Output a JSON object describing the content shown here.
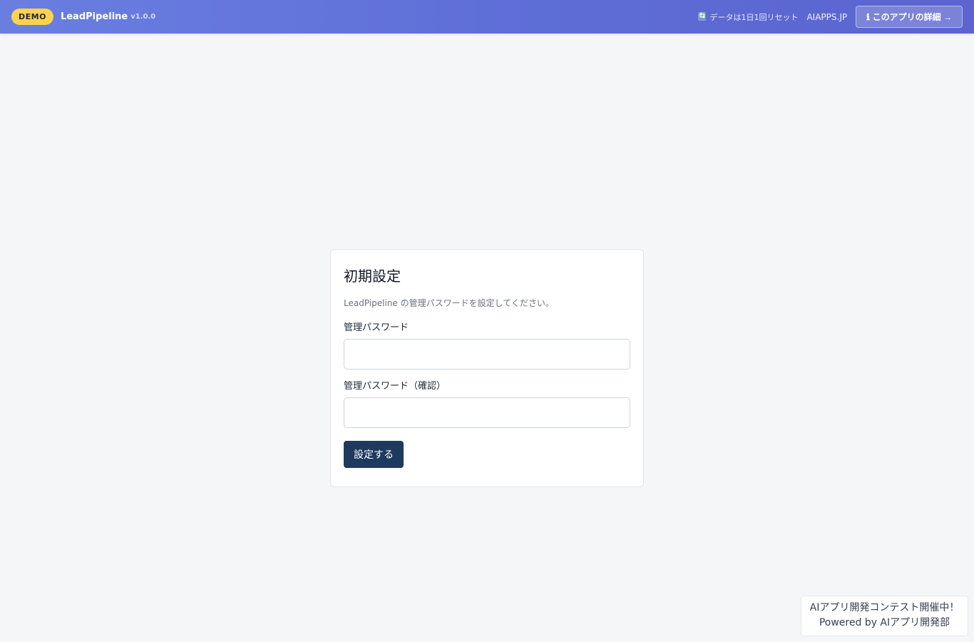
{
  "header": {
    "badge": "DEMO",
    "app_name": "LeadPipeline",
    "version": "v1.0.0",
    "reset_icon": "🔄",
    "reset_note": "データは1日1回リセット",
    "site_link": "AIAPPS.JP",
    "detail_icon": "ℹ",
    "detail_button": "このアプリの詳細 →"
  },
  "setup": {
    "title": "初期設定",
    "description": "LeadPipeline の管理パスワードを設定してください。",
    "password_label": "管理パスワード",
    "password_value": "",
    "confirm_label": "管理パスワード（確認）",
    "confirm_value": "",
    "submit_label": "設定する"
  },
  "promo": {
    "line1": "AIアプリ開発コンテスト開催中！",
    "line2": "Powered by AIアプリ開発部"
  },
  "colors": {
    "header_gradient_start": "#6a7ee0",
    "header_gradient_end": "#5b64cf",
    "badge": "#fcd34d",
    "primary_button": "#1e3a5f",
    "background": "#f5f6f8"
  }
}
